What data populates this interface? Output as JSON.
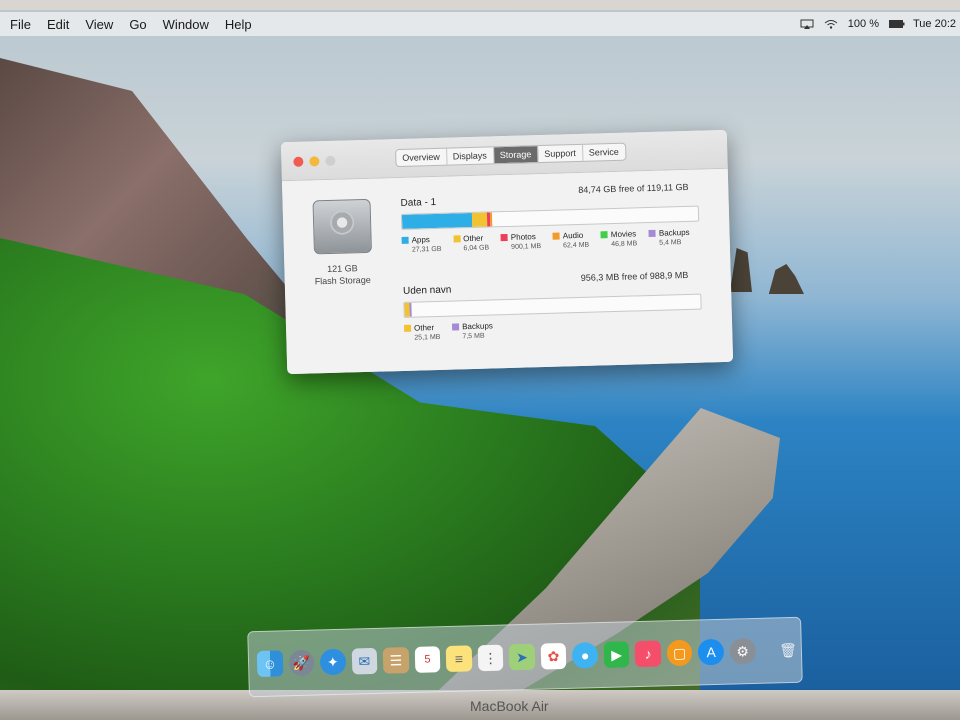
{
  "menubar": {
    "items": [
      "File",
      "Edit",
      "View",
      "Go",
      "Window",
      "Help"
    ],
    "battery": "100 %",
    "clock": "Tue 20:2"
  },
  "window": {
    "tabs": [
      "Overview",
      "Displays",
      "Storage",
      "Support",
      "Service"
    ],
    "active_tab": "Storage",
    "disk": {
      "size": "121 GB",
      "type": "Flash Storage"
    },
    "volumes": [
      {
        "name": "Data - 1",
        "free": "84,74 GB free of 119,11 GB",
        "legend": [
          {
            "label": "Apps",
            "size": "27,31 GB",
            "color": "#2eaee6"
          },
          {
            "label": "Other",
            "size": "6,04 GB",
            "color": "#f2c230"
          },
          {
            "label": "Photos",
            "size": "900,1 MB",
            "color": "#ec3d5b"
          },
          {
            "label": "Audio",
            "size": "62,4 MB",
            "color": "#f39b2a"
          },
          {
            "label": "Movies",
            "size": "46,8 MB",
            "color": "#3fcf4a"
          },
          {
            "label": "Backups",
            "size": "5,4 MB",
            "color": "#a58ad8"
          }
        ]
      },
      {
        "name": "Uden navn",
        "free": "956,3 MB free of 988,9 MB",
        "legend": [
          {
            "label": "Other",
            "size": "25,1 MB",
            "color": "#f2c230"
          },
          {
            "label": "Backups",
            "size": "7,5 MB",
            "color": "#a58ad8"
          }
        ]
      }
    ]
  },
  "bezel_text": "MacBook Air",
  "dock": {
    "apps": [
      "finder-icon",
      "launchpad-icon",
      "safari-icon",
      "mail-icon",
      "contacts-icon",
      "calendar-icon",
      "notes-icon",
      "reminders-icon",
      "maps-icon",
      "photos-icon",
      "messages-icon",
      "facetime-icon",
      "music-icon",
      "books-icon",
      "app-store-icon",
      "system-preferences-icon",
      "trash-icon"
    ],
    "calendar_day": "5"
  }
}
